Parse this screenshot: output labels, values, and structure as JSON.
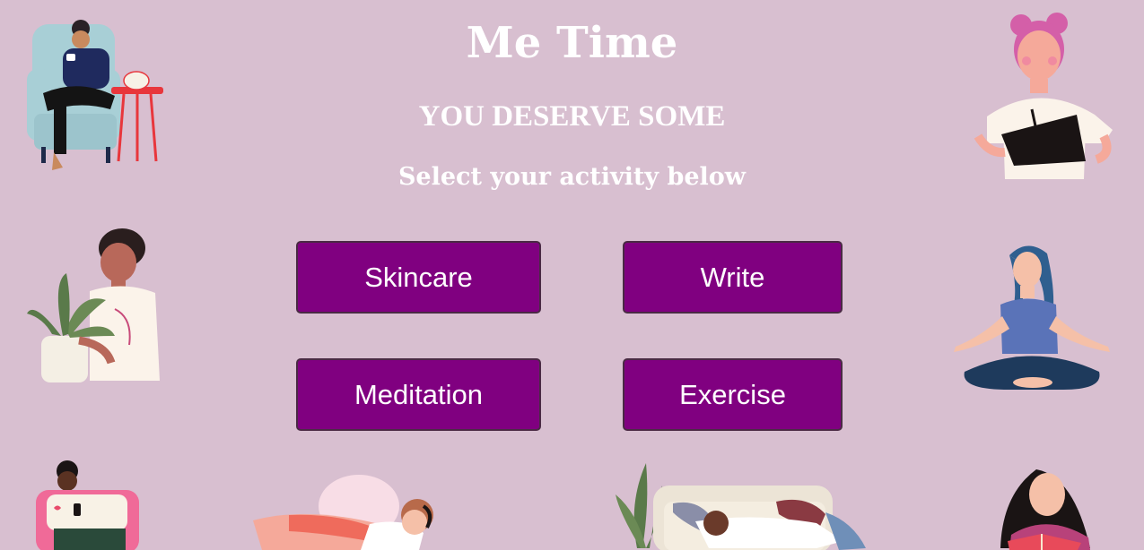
{
  "header": {
    "title": "Me Time",
    "subtitle": "YOU DESERVE SOME",
    "prompt": "Select your activity below"
  },
  "activities": [
    {
      "label": "Skincare"
    },
    {
      "label": "Write"
    },
    {
      "label": "Meditation"
    },
    {
      "label": "Exercise"
    }
  ],
  "colors": {
    "background": "#d8bfd0",
    "button": "#800080",
    "text": "#ffffff"
  }
}
